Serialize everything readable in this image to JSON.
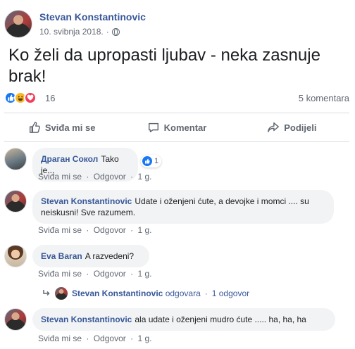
{
  "post": {
    "author": "Stevan Konstantinovic",
    "date": "10. svibnja 2018.",
    "separator": "·",
    "text": "Ko želi da upropasti ljubav - neka zasnuje brak!"
  },
  "reactions": {
    "count": "16",
    "comments_count": "5 komentara",
    "icons": [
      "like-icon",
      "haha-icon",
      "love-icon"
    ]
  },
  "actions": {
    "like_label": "Sviđa mi se",
    "comment_label": "Komentar",
    "share_label": "Podijeli"
  },
  "comments": [
    {
      "name": "Драган Сокол",
      "text": "Tako je...",
      "like_count": "1",
      "links": {
        "like": "Sviđa mi se",
        "reply": "Odgovor",
        "time": "1 g.",
        "dot": "·"
      }
    },
    {
      "name": "Stevan Konstantinovic",
      "text": "Udate i oženjeni ćute, a devojke i momci .... su neiskusni! Sve razumem.",
      "links": {
        "like": "Sviđa mi se",
        "reply": "Odgovor",
        "time": "1 g.",
        "dot": "·"
      }
    },
    {
      "name": "Eva Baran",
      "text": "A razvedeni?",
      "links": {
        "like": "Sviđa mi se",
        "reply": "Odgovor",
        "time": "1 g.",
        "dot": "·"
      }
    },
    {
      "name": "Stevan Konstantinovic",
      "text": "ala udate i oženjeni mudro ćute ..... ha, ha, ha",
      "links": {
        "like": "Sviđa mi se",
        "reply": "Odgovor",
        "time": "1 g.",
        "dot": "·"
      }
    }
  ],
  "reply_preview": {
    "name": "Stevan Konstantinovic",
    "action": "odgovara",
    "dot": "·",
    "count": "1 odgovor"
  },
  "colors": {
    "link_blue": "#385898",
    "like_blue": "#1877f2",
    "meta_gray": "#606770",
    "bubble_bg": "#f2f3f5"
  }
}
